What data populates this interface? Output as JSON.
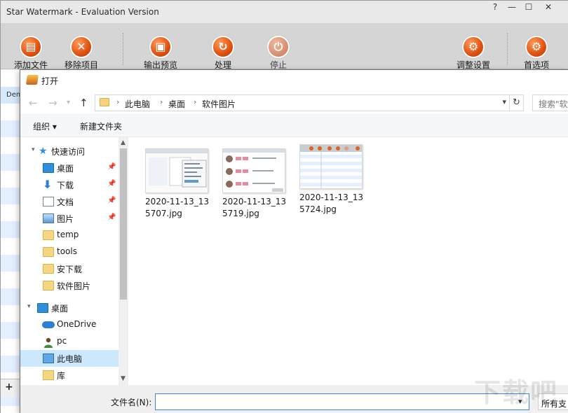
{
  "app": {
    "title": "Star Watermark - Evaluation Version",
    "window_controls": [
      "?",
      "—",
      "☐",
      "✕"
    ],
    "toolbar": [
      {
        "label": "添加文件",
        "icon": "add-file-icon"
      },
      {
        "label": "移除项目",
        "icon": "remove-item-icon"
      },
      {
        "label": "输出预览",
        "icon": "output-preview-icon"
      },
      {
        "label": "处理",
        "icon": "process-icon"
      },
      {
        "label": "停止",
        "icon": "stop-icon"
      },
      {
        "label": "调整设置",
        "icon": "adjust-settings-icon"
      },
      {
        "label": "首选项",
        "icon": "preferences-icon"
      }
    ],
    "left_list_header": "Dem",
    "add_symbol": "+"
  },
  "dialog": {
    "title": "打开",
    "breadcrumb": [
      "此电脑",
      "桌面",
      "软件图片"
    ],
    "search_placeholder": "搜索\"软",
    "commands": {
      "organize": "组织 ▾",
      "new_folder": "新建文件夹"
    },
    "nav": [
      {
        "label": "快速访问",
        "icon": "star",
        "indent": 1
      },
      {
        "label": "桌面",
        "icon": "desktop",
        "pinned": true,
        "indent": 2
      },
      {
        "label": "下载",
        "icon": "down",
        "pinned": true,
        "indent": 2
      },
      {
        "label": "文档",
        "icon": "doc",
        "pinned": true,
        "indent": 2
      },
      {
        "label": "图片",
        "icon": "pic",
        "pinned": true,
        "indent": 2
      },
      {
        "label": "temp",
        "icon": "folder",
        "indent": 2
      },
      {
        "label": "tools",
        "icon": "folder",
        "indent": 2
      },
      {
        "label": "安下载",
        "icon": "folder",
        "indent": 2
      },
      {
        "label": "软件图片",
        "icon": "folder",
        "indent": 2
      },
      {
        "label": "桌面",
        "icon": "desktop",
        "indent": 1
      },
      {
        "label": "OneDrive",
        "icon": "cloud",
        "indent": 2
      },
      {
        "label": "pc",
        "icon": "user",
        "indent": 2
      },
      {
        "label": "此电脑",
        "icon": "pc",
        "indent": 2,
        "selected": true
      },
      {
        "label": "库",
        "icon": "lib",
        "indent": 2
      }
    ],
    "files": [
      {
        "name": "2020-11-13_135707.jpg"
      },
      {
        "name": "2020-11-13_135719.jpg"
      },
      {
        "name": "2020-11-13_135724.jpg"
      }
    ],
    "filename_label": "文件名(N):",
    "filename_value": "",
    "filetype_label": "所有支"
  },
  "watermark_text": "下载吧"
}
